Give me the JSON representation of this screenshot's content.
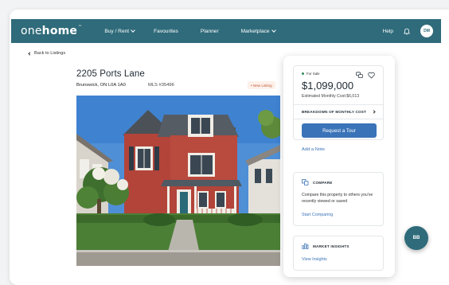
{
  "brand": {
    "logo_pre": "one",
    "logo_bold": "home",
    "logo_tm": "™"
  },
  "nav": {
    "buy_rent": "Buy / Rent",
    "favourites": "Favourites",
    "planner": "Planner",
    "marketplace": "Marketplace",
    "help": "Help",
    "user_initials": "DM"
  },
  "back_label": "Back to Listings",
  "listing": {
    "address": "2205 Ports Lane",
    "city": "Brunswick, ON L0A 1A0",
    "mls": "MLS #35496",
    "badge": "• New Listing"
  },
  "sidebar": {
    "status": "For Sale",
    "price": "$1,099,000",
    "estimated_cost": "Estimated Monthly Cost:$6,013",
    "breakdown": "BREAKDOWN OF MONTHLY COST",
    "tour_button": "Request a Tour",
    "add_note": "Add a Note",
    "compare": {
      "title": "COMPARE",
      "text": "Compare this property to others you've recently viewed or saved",
      "link": "Start Comparing"
    },
    "insights": {
      "title": "MARKET INSIGHTS",
      "link": "View Insights"
    }
  },
  "fab_initials": "BB",
  "colors": {
    "nav": "#2f6b7a",
    "accent": "#3a73b8",
    "status_dot": "#2f8a5a"
  }
}
